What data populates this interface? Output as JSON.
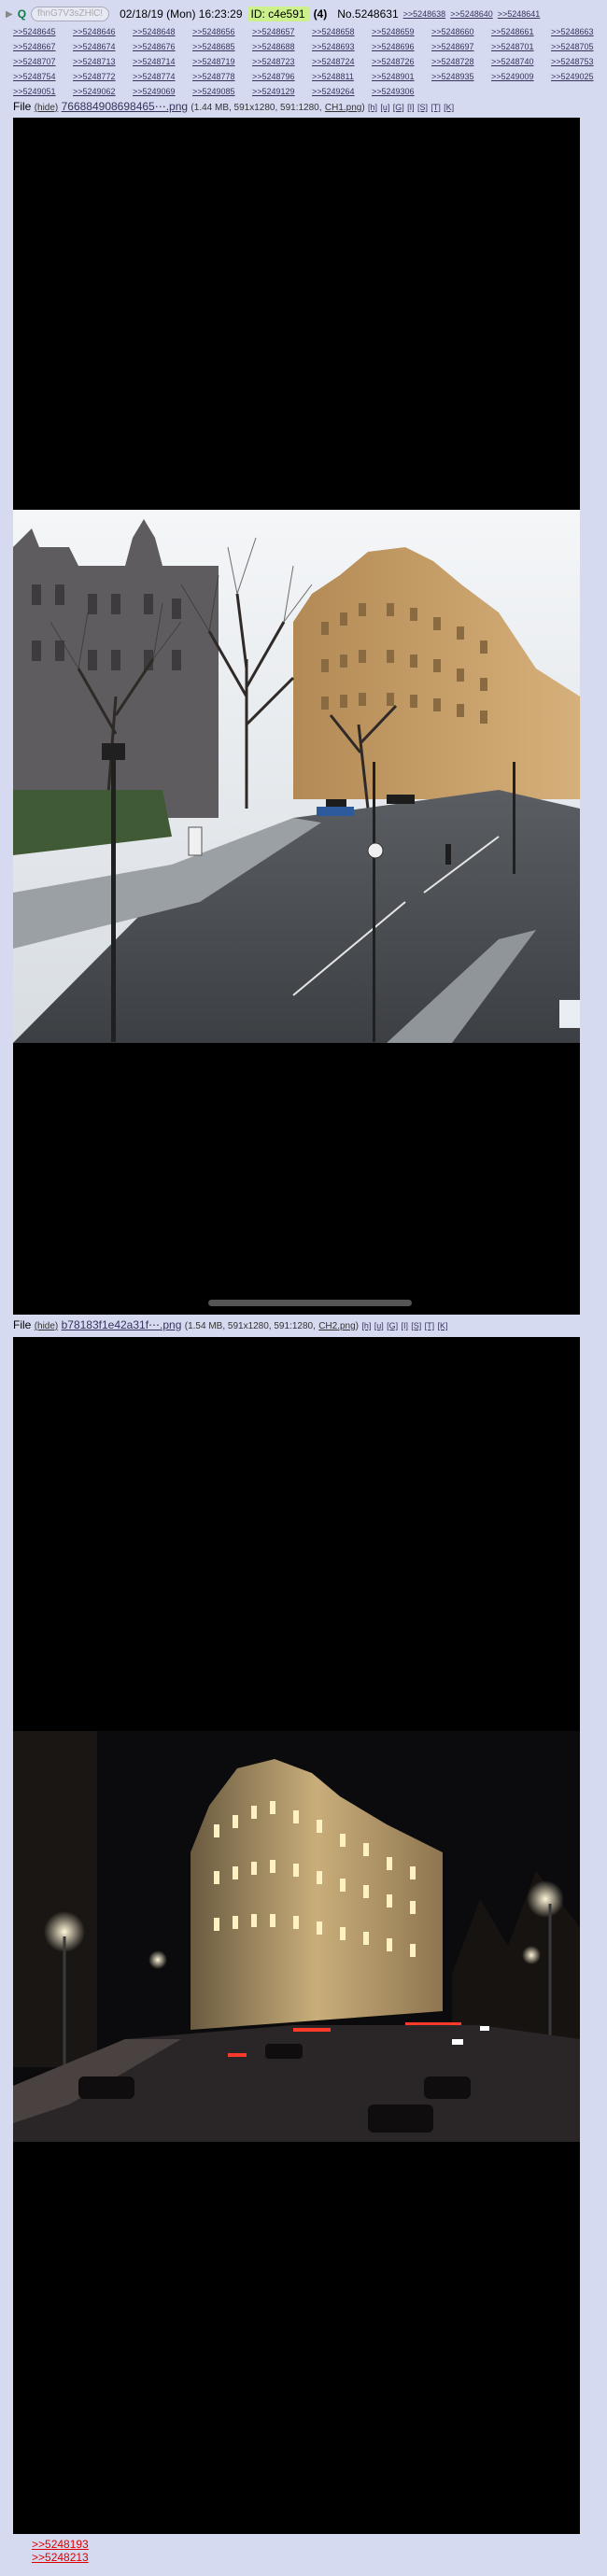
{
  "post": {
    "arrow": "▶",
    "q_icon": "Q",
    "user_id_hash": "fhnG7V3sZHlC!",
    "datetime": "02/18/19 (Mon) 16:23:29",
    "poster_id": "ID: c4e591",
    "reply_count": "(4)",
    "number": "No.5248631",
    "header_backlinks": [
      ">>5248638",
      ">>5248640",
      ">>5248641"
    ],
    "backlink_rows": [
      [
        ">>5248645",
        ">>5248646",
        ">>5248648",
        ">>5248656",
        ">>5248657",
        ">>5248658",
        ">>5248659",
        ">>5248660",
        ">>5248661",
        ">>5248663"
      ],
      [
        ">>5248667",
        ">>5248674",
        ">>5248676",
        ">>5248685",
        ">>5248688",
        ">>5248693",
        ">>5248696",
        ">>5248697",
        ">>5248701",
        ">>5248705"
      ],
      [
        ">>5248707",
        ">>5248713",
        ">>5248714",
        ">>5248719",
        ">>5248723",
        ">>5248724",
        ">>5248726",
        ">>5248728",
        ">>5248740",
        ">>5248753"
      ],
      [
        ">>5248754",
        ">>5248772",
        ">>5248774",
        ">>5248778",
        ">>5248796",
        ">>5248811",
        ">>5248901",
        ">>5248935",
        ">>5249009",
        ">>5249025"
      ],
      [
        ">>5249051",
        ">>5249062",
        ">>5249069",
        ">>5249085",
        ">>5249129",
        ">>5249264",
        ">>5249306"
      ]
    ]
  },
  "files": [
    {
      "label": "File",
      "hide": "(hide)",
      "filename": "766884908698465⋯.png",
      "meta": "(1.44 MB, 591x1280, 591:1280,",
      "original": "CH1.png",
      "meta_close": ")",
      "tools": [
        "[h]",
        "[u]",
        "[G]",
        "[I]",
        "[S]",
        "[T]",
        "[K]"
      ]
    },
    {
      "label": "File",
      "hide": "(hide)",
      "filename": "b78183f1e42a31f⋯.png",
      "meta": "(1.54 MB, 591x1280, 591:1280,",
      "original": "CH2.png",
      "meta_close": ")",
      "tools": [
        "[h]",
        "[u]",
        "[G]",
        "[I]",
        "[S]",
        "[T]",
        "[K]"
      ]
    }
  ],
  "quote_links": [
    ">>5248193",
    ">>5248213"
  ],
  "colors": {
    "background": "#d6daf0",
    "link": "#34345c",
    "id_highlight": "#ccf08c",
    "quotelink": "#dd0000"
  },
  "icons": {
    "arrow": "triangle-right-icon",
    "q": "q-icon"
  }
}
